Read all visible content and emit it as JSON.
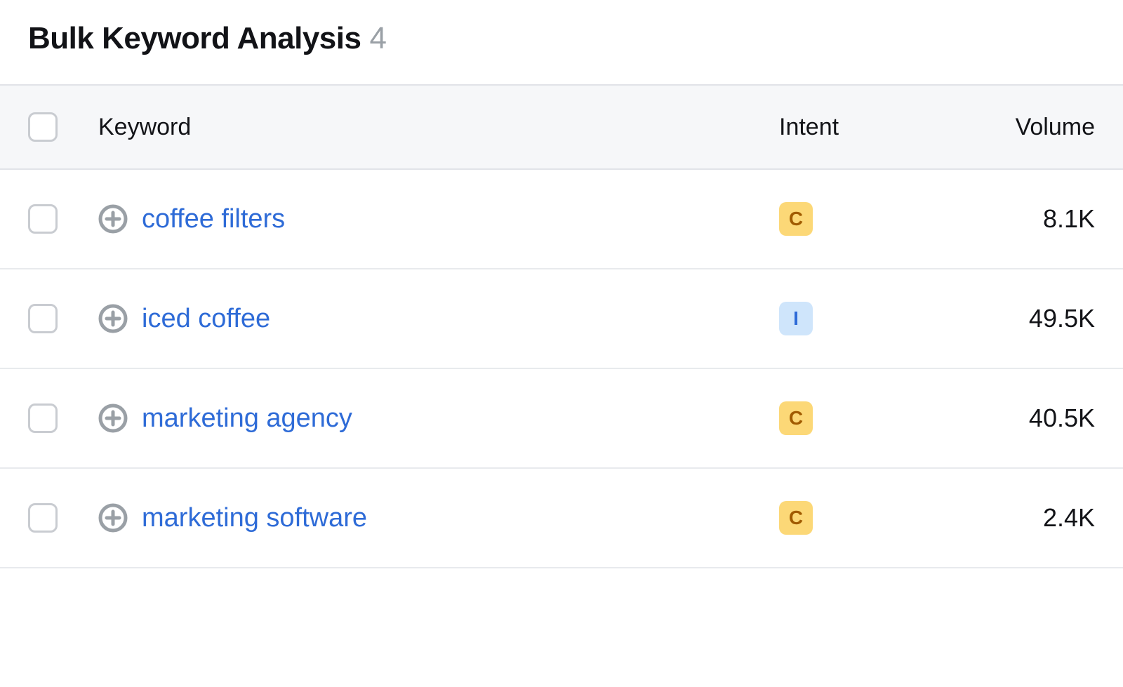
{
  "title": "Bulk Keyword Analysis",
  "count": "4",
  "columns": {
    "keyword": "Keyword",
    "intent": "Intent",
    "volume": "Volume"
  },
  "rows": [
    {
      "keyword": "coffee filters",
      "intent": "C",
      "volume": "8.1K"
    },
    {
      "keyword": "iced coffee",
      "intent": "I",
      "volume": "49.5K"
    },
    {
      "keyword": "marketing agency",
      "intent": "C",
      "volume": "40.5K"
    },
    {
      "keyword": "marketing software",
      "intent": "C",
      "volume": "2.4K"
    }
  ]
}
